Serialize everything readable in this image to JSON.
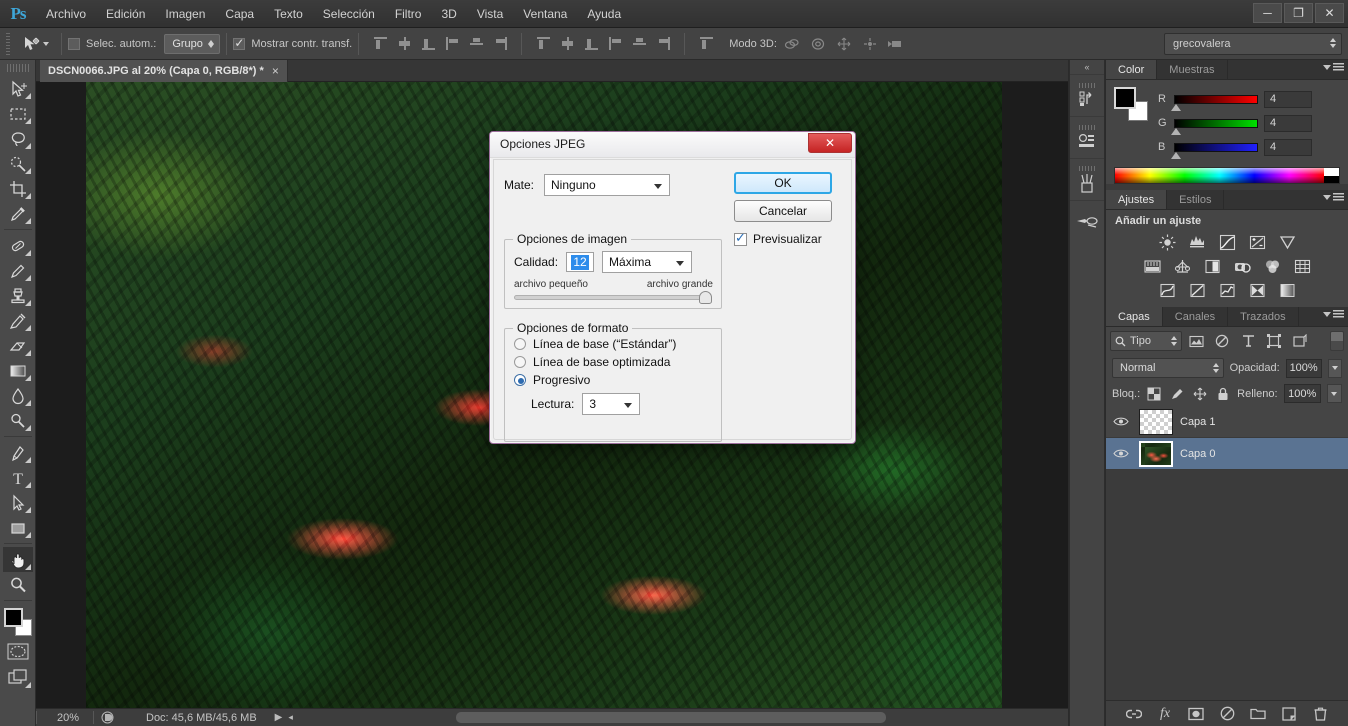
{
  "app": {
    "logo": "Ps",
    "menus": [
      "Archivo",
      "Edición",
      "Imagen",
      "Capa",
      "Texto",
      "Selección",
      "Filtro",
      "3D",
      "Vista",
      "Ventana",
      "Ayuda"
    ],
    "window_controls": {
      "minimize": "─",
      "restore": "❐",
      "close": "✕"
    }
  },
  "options_bar": {
    "auto_select_label": "Selec. autom.:",
    "auto_select_value": "Grupo",
    "show_transform_label": "Mostrar contr. transf.",
    "show_transform_checked": true,
    "mode3d_label": "Modo 3D:",
    "workspace": "grecovalera",
    "align_icons": [
      "align-top-edges-icon",
      "align-vertical-centers-icon",
      "align-bottom-edges-icon",
      "align-left-edges-icon",
      "align-horizontal-centers-icon",
      "align-right-edges-icon",
      "distribute-top-edges-icon",
      "distribute-vertical-centers-icon",
      "distribute-bottom-edges-icon",
      "distribute-left-edges-icon",
      "distribute-horizontal-centers-icon",
      "distribute-right-edges-icon",
      "auto-align-layers-icon"
    ],
    "mode3d_icons": [
      "rotate-3d-icon",
      "roll-3d-icon",
      "pan-3d-icon",
      "slide-3d-icon",
      "scale-3d-icon"
    ]
  },
  "toolbar": {
    "tools": [
      {
        "name": "move-tool",
        "has_flyout": true,
        "active": false
      },
      {
        "name": "rectangular-marquee-tool",
        "has_flyout": true,
        "active": false
      },
      {
        "name": "lasso-tool",
        "has_flyout": true,
        "active": false
      },
      {
        "name": "quick-selection-tool",
        "has_flyout": true,
        "active": false
      },
      {
        "name": "crop-tool",
        "has_flyout": true,
        "active": false
      },
      {
        "name": "eyedropper-tool",
        "has_flyout": true,
        "active": false
      },
      {
        "name": "spot-healing-brush-tool",
        "has_flyout": true,
        "active": false
      },
      {
        "name": "brush-tool",
        "has_flyout": true,
        "active": false
      },
      {
        "name": "clone-stamp-tool",
        "has_flyout": true,
        "active": false
      },
      {
        "name": "history-brush-tool",
        "has_flyout": true,
        "active": false
      },
      {
        "name": "eraser-tool",
        "has_flyout": true,
        "active": false
      },
      {
        "name": "gradient-tool",
        "has_flyout": true,
        "active": false
      },
      {
        "name": "blur-tool",
        "has_flyout": true,
        "active": false
      },
      {
        "name": "dodge-tool",
        "has_flyout": true,
        "active": false
      },
      {
        "name": "pen-tool",
        "has_flyout": true,
        "active": false
      },
      {
        "name": "horizontal-type-tool",
        "has_flyout": true,
        "active": false
      },
      {
        "name": "path-selection-tool",
        "has_flyout": true,
        "active": false
      },
      {
        "name": "rectangle-tool",
        "has_flyout": true,
        "active": false
      },
      {
        "name": "hand-tool",
        "has_flyout": true,
        "active": true
      },
      {
        "name": "zoom-tool",
        "has_flyout": false,
        "active": false
      }
    ],
    "foreground_color": "#000000",
    "background_color": "#ffffff"
  },
  "document": {
    "tab_title": "DSCN0066.JPG al 20% (Capa 0, RGB/8*) *",
    "close_glyph": "×"
  },
  "status_bar": {
    "zoom": "20%",
    "doc_info": "Doc: 45,6 MB/45,6 MB"
  },
  "mini_dock": {
    "collapse_glyph": "«",
    "cells": [
      "history-panel-icon",
      "measurement-log-icon",
      "brushes-panel-icon",
      "tool-presets-icon"
    ]
  },
  "color_panel": {
    "tabs": [
      {
        "label": "Color",
        "active": true
      },
      {
        "label": "Muestras",
        "active": false
      }
    ],
    "channels": [
      {
        "label": "R",
        "value": "4"
      },
      {
        "label": "G",
        "value": "4"
      },
      {
        "label": "B",
        "value": "4"
      }
    ]
  },
  "adjustments_panel": {
    "tabs": [
      {
        "label": "Ajustes",
        "active": true
      },
      {
        "label": "Estilos",
        "active": false
      }
    ],
    "heading": "Añadir un ajuste",
    "rows": [
      [
        "brightness-contrast-icon",
        "levels-icon",
        "curves-icon",
        "exposure-icon",
        "vibrance-icon"
      ],
      [
        "hue-saturation-icon",
        "color-balance-icon",
        "black-white-icon",
        "photo-filter-icon",
        "channel-mixer-icon",
        "color-lookup-icon"
      ],
      [
        "invert-icon",
        "posterize-icon",
        "threshold-icon",
        "selective-color-icon",
        "gradient-map-icon"
      ]
    ]
  },
  "layers_panel": {
    "tabs": [
      {
        "label": "Capas",
        "active": true
      },
      {
        "label": "Canales",
        "active": false
      },
      {
        "label": "Trazados",
        "active": false
      }
    ],
    "filter_label": "Tipo",
    "filter_icons": [
      "filter-pixel-icon",
      "filter-adjustment-icon",
      "filter-type-icon",
      "filter-shape-icon",
      "filter-smart-object-icon"
    ],
    "blend_mode": "Normal",
    "opacity_label": "Opacidad:",
    "opacity_value": "100%",
    "lock_label": "Bloq.:",
    "lock_icons": [
      "lock-transparent-pixels-icon",
      "lock-image-pixels-icon",
      "lock-position-icon",
      "lock-all-icon"
    ],
    "fill_label": "Relleno:",
    "fill_value": "100%",
    "layers": [
      {
        "name": "Capa 1",
        "visible": true,
        "selected": false,
        "thumb": "transparent"
      },
      {
        "name": "Capa 0",
        "visible": true,
        "selected": true,
        "thumb": "photo"
      }
    ],
    "bottom_icons": [
      "link-layers-icon",
      "layer-style-icon",
      "layer-mask-icon",
      "new-adjustment-layer-icon",
      "new-group-icon",
      "new-layer-icon",
      "delete-layer-icon"
    ]
  },
  "dialog": {
    "title": "Opciones JPEG",
    "close_glyph": "✕",
    "mate_label": "Mate:",
    "mate_value": "Ninguno",
    "ok_label": "OK",
    "cancel_label": "Cancelar",
    "preview_label": "Previsualizar",
    "preview_checked": true,
    "image_options": {
      "legend": "Opciones de imagen",
      "quality_label": "Calidad:",
      "quality_value": "12",
      "quality_preset": "Máxima",
      "slider_min_label": "archivo pequeño",
      "slider_max_label": "archivo grande",
      "slider_position_pct": 100
    },
    "format_options": {
      "legend": "Opciones de formato",
      "radios": [
        {
          "label": "Línea de base (“Estándar”)",
          "selected": false
        },
        {
          "label": "Línea de base optimizada",
          "selected": false
        },
        {
          "label": "Progresivo",
          "selected": true
        }
      ],
      "scans_label": "Lectura:",
      "scans_value": "3"
    }
  }
}
